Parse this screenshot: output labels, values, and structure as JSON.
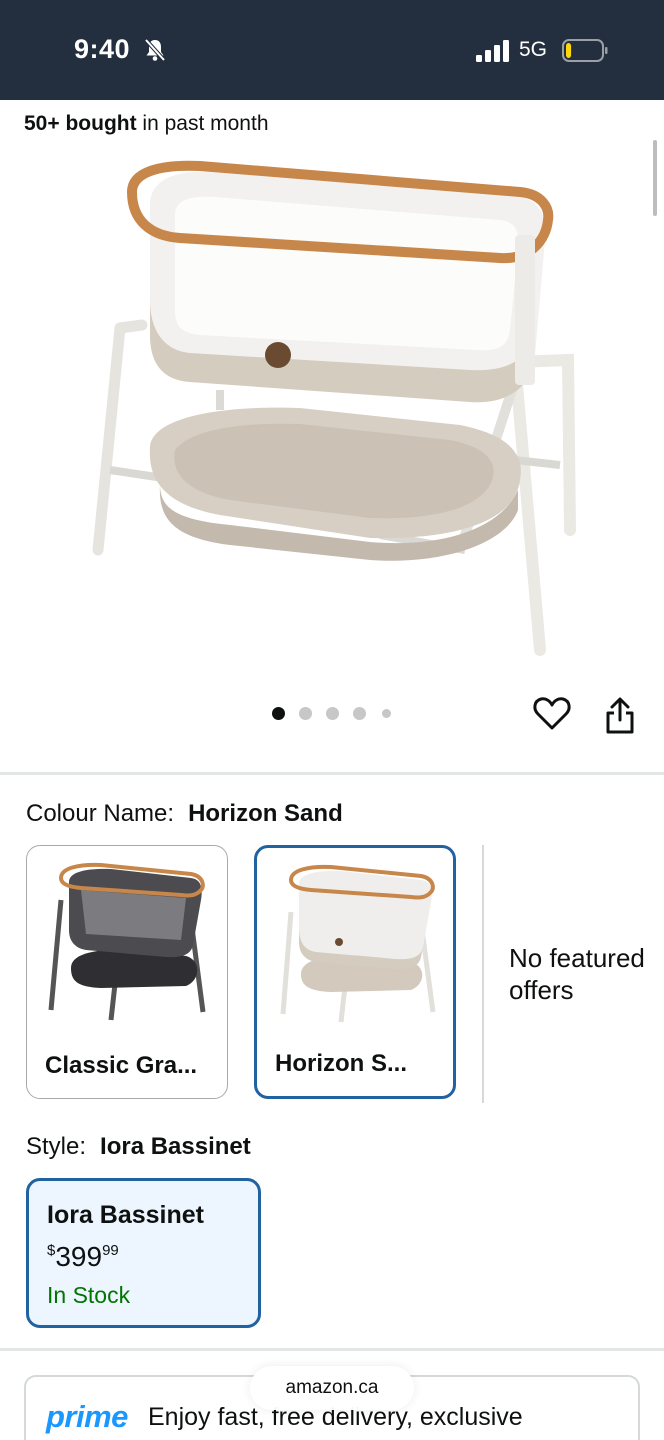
{
  "status_bar": {
    "time": "9:40",
    "network": "5G",
    "icons": [
      "bell-slash-icon",
      "signal-icon",
      "battery-icon"
    ],
    "battery_level": 0.15,
    "battery_color": "#ffd60a"
  },
  "social_proof": {
    "count": "50+ bought",
    "suffix": " in past month"
  },
  "gallery": {
    "image_count": 5,
    "active_index": 0
  },
  "actions": {
    "wishlist_icon": "heart-icon",
    "share_icon": "share-icon"
  },
  "colour": {
    "label": "Colour Name:",
    "selected": "Horizon Sand",
    "options": [
      {
        "name": "Classic Gra...",
        "selected": false
      },
      {
        "name": "Horizon S...",
        "selected": true
      }
    ],
    "no_offers": "No featured offers"
  },
  "style": {
    "label": "Style:",
    "selected": "Iora Bassinet",
    "card": {
      "name": "Iora Bassinet",
      "currency": "$",
      "price_whole": "399",
      "price_fraction": "99",
      "stock": "In Stock"
    }
  },
  "prime": {
    "logo": "prime",
    "text": "Enjoy fast, free delivery, exclusive"
  },
  "browser": {
    "url": "amazon.ca"
  },
  "colors": {
    "header": "#232f3e",
    "selected_border": "#2162a1",
    "in_stock": "#007600",
    "prime_blue": "#1a98ff"
  }
}
